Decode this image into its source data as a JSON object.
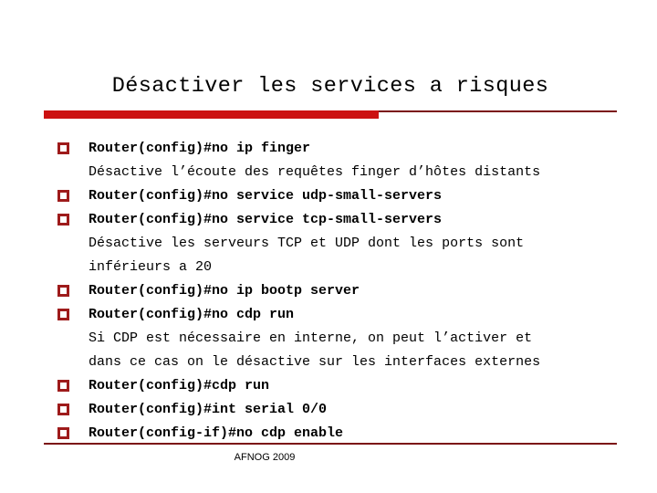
{
  "slide": {
    "title": "Désactiver les services a risques",
    "footer": "AFNOG 2009",
    "colors": {
      "accent_red": "#cc1111",
      "accent_dark_red": "#7b1113",
      "bullet_red": "#9e1b1b",
      "text": "#000000",
      "background": "#ffffff"
    },
    "lines": [
      {
        "kind": "bullet",
        "text": "Router(config)#no ip finger"
      },
      {
        "kind": "description",
        "text": "Désactive l’écoute des requêtes finger d’hôtes distants"
      },
      {
        "kind": "bullet",
        "text": "Router(config)#no service udp-small-servers"
      },
      {
        "kind": "bullet",
        "text": "Router(config)#no service tcp-small-servers"
      },
      {
        "kind": "description",
        "text": "Désactive les serveurs TCP et UDP dont les ports sont"
      },
      {
        "kind": "description",
        "text": "inférieurs a 20"
      },
      {
        "kind": "bullet",
        "text": "Router(config)#no ip bootp server"
      },
      {
        "kind": "bullet",
        "text": "Router(config)#no cdp run"
      },
      {
        "kind": "description",
        "text": "Si CDP est nécessaire en interne, on peut l’activer et"
      },
      {
        "kind": "description",
        "text": "dans ce cas on le désactive sur les interfaces externes"
      },
      {
        "kind": "bullet",
        "text": "Router(config)#cdp run"
      },
      {
        "kind": "bullet",
        "text": "Router(config)#int serial 0/0"
      },
      {
        "kind": "bullet",
        "text": "Router(config-if)#no cdp enable"
      }
    ]
  }
}
